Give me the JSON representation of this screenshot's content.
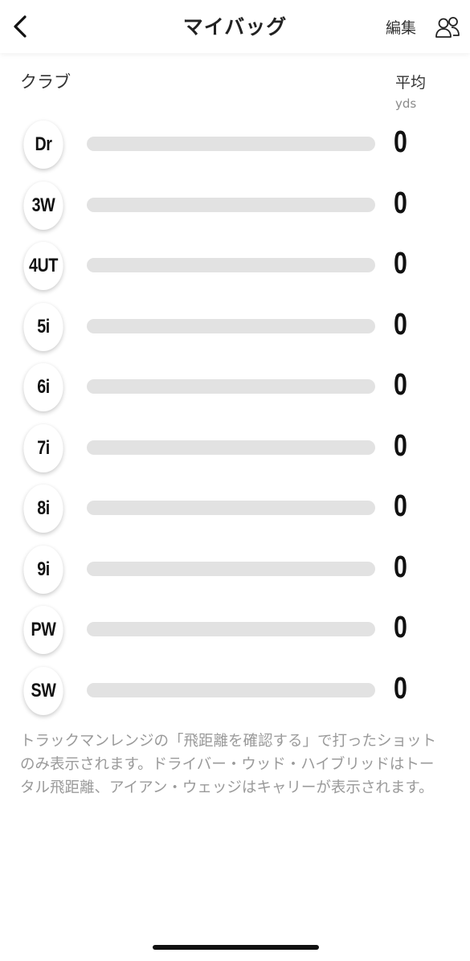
{
  "header": {
    "title": "マイバッグ",
    "edit_label": "編集"
  },
  "columns": {
    "club": "クラブ",
    "average": "平均",
    "unit": "yds"
  },
  "clubs": [
    {
      "name": "Dr",
      "average": "0",
      "fill": 0
    },
    {
      "name": "3W",
      "average": "0",
      "fill": 0
    },
    {
      "name": "4UT",
      "average": "0",
      "fill": 0
    },
    {
      "name": "5i",
      "average": "0",
      "fill": 0
    },
    {
      "name": "6i",
      "average": "0",
      "fill": 0
    },
    {
      "name": "7i",
      "average": "0",
      "fill": 0
    },
    {
      "name": "8i",
      "average": "0",
      "fill": 0
    },
    {
      "name": "9i",
      "average": "0",
      "fill": 0
    },
    {
      "name": "PW",
      "average": "0",
      "fill": 0
    },
    {
      "name": "SW",
      "average": "0",
      "fill": 0
    }
  ],
  "note": "トラックマンレンジの「飛距離を確認する」で打ったショットのみ表示されます。ドライバー・ウッド・ハイブリッドはトータル飛距離、アイアン・ウェッジはキャリーが表示されます。",
  "colors": {
    "track": "#e2e2e2",
    "text": "#111111",
    "note": "#9a9a9a"
  }
}
